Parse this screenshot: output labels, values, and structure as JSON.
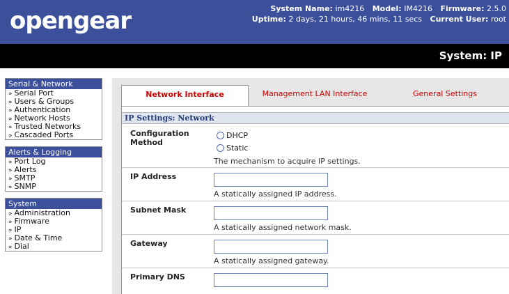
{
  "header": {
    "logo": "opengear",
    "system_name_label": "System Name:",
    "system_name": "im4216",
    "model_label": "Model:",
    "model": "IM4216",
    "firmware_label": "Firmware:",
    "firmware": "2.5.0",
    "uptime_label": "Uptime:",
    "uptime": "2 days, 21 hours, 46 mins, 11 secs",
    "user_label": "Current User:",
    "user": "root",
    "page_title": "System: IP"
  },
  "sidebar": {
    "groups": [
      {
        "title": "Serial & Network",
        "items": [
          "Serial Port",
          "Users & Groups",
          "Authentication",
          "Network Hosts",
          "Trusted Networks",
          "Cascaded Ports"
        ]
      },
      {
        "title": "Alerts & Logging",
        "items": [
          "Port Log",
          "Alerts",
          "SMTP",
          "SNMP"
        ]
      },
      {
        "title": "System",
        "items": [
          "Administration",
          "Firmware",
          "IP",
          "Date & Time",
          "Dial"
        ]
      }
    ],
    "bullet": "»"
  },
  "tabs": [
    "Network Interface",
    "Management LAN Interface",
    "General Settings"
  ],
  "section": {
    "title": "IP Settings: Network"
  },
  "form": {
    "config_label_line1": "Configuration",
    "config_label_line2": "Method",
    "radio_dhcp": "DHCP",
    "radio_static": "Static",
    "config_help": "The mechanism to acquire IP settings.",
    "ip_label": "IP Address",
    "ip_value": "",
    "ip_help": "A statically assigned IP address.",
    "mask_label": "Subnet Mask",
    "mask_value": "",
    "mask_help": "A statically assigned network mask.",
    "gw_label": "Gateway",
    "gw_value": "",
    "gw_help": "A statically assigned gateway.",
    "dns_label": "Primary DNS",
    "dns_value": ""
  },
  "colors": {
    "brand_blue": "#3b4f9b",
    "tab_red": "#cc0000",
    "section_bg": "#dfe6f0"
  }
}
